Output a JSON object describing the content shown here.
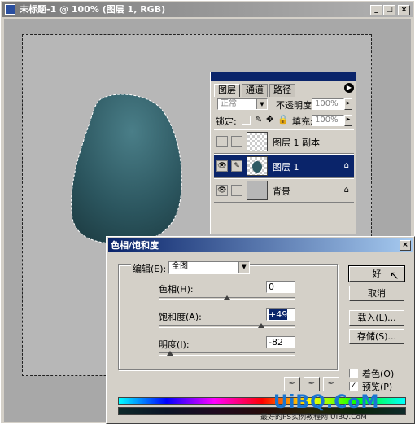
{
  "document": {
    "title": "未标题-1 @ 100% (图层 1, RGB)",
    "controls": {
      "minimize": "_",
      "maximize": "□",
      "close": "×"
    }
  },
  "layers_panel": {
    "tabs": [
      "图层",
      "通道",
      "路径"
    ],
    "blend_mode": "正常",
    "opacity_label": "不透明度:",
    "opacity_value": "100%",
    "lock_label": "锁定:",
    "fill_label": "填充:",
    "fill_value": "100%",
    "layers": [
      {
        "name": "图层 1 副本",
        "visible": false,
        "selected": false,
        "locked": false
      },
      {
        "name": "图层 1",
        "visible": true,
        "selected": true,
        "locked": true
      },
      {
        "name": "背景",
        "visible": true,
        "selected": false,
        "locked": true
      }
    ]
  },
  "hue_saturation": {
    "title": "色相/饱和度",
    "edit_label": "编辑(E):",
    "edit_value": "全图",
    "hue_label": "色相(H):",
    "hue_value": "0",
    "saturation_label": "饱和度(A):",
    "saturation_value": "+49",
    "lightness_label": "明度(I):",
    "lightness_value": "-82",
    "ok_label": "好",
    "cancel_label": "取消",
    "load_label": "载入(L)...",
    "save_label": "存储(S)...",
    "colorize_label": "着色(O)",
    "colorize_checked": false,
    "preview_label": "预览(P)",
    "preview_checked": true
  },
  "colors": {
    "shape": "#2f5a63",
    "selection": "#0a246a"
  },
  "watermark": {
    "logo": "UiBQ.CoM",
    "sub": "最好的PS实例教程网 UiBQ.CoM"
  }
}
